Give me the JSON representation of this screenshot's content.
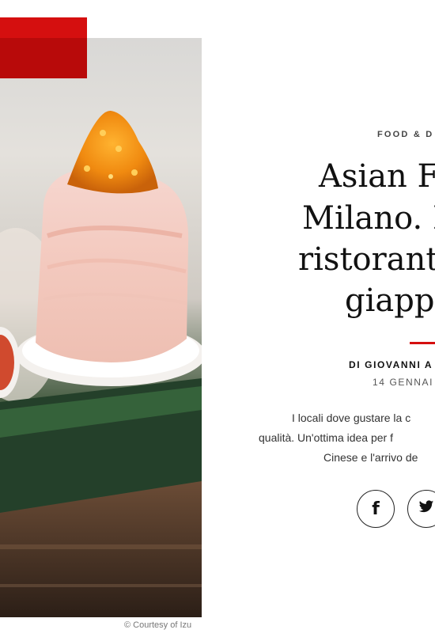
{
  "hero": {
    "credit": "© Courtesy of Izu",
    "badge_color": "#d50f0f"
  },
  "article": {
    "category": "FOOD & D",
    "title_lines": [
      "Asian Fu",
      "Milano. I",
      "ristoranti",
      "giappo"
    ],
    "byline": "DI GIOVANNI A",
    "date": "14 GENNAI",
    "summary_lines": [
      "I locali dove gustare la c",
      "qualità. Un'ottima idea per f",
      "Cinese e l'arrivo de"
    ]
  },
  "share": {
    "facebook_icon": "f",
    "twitter_icon": "twitter-bird"
  },
  "colors": {
    "accent": "#d50f0f"
  }
}
